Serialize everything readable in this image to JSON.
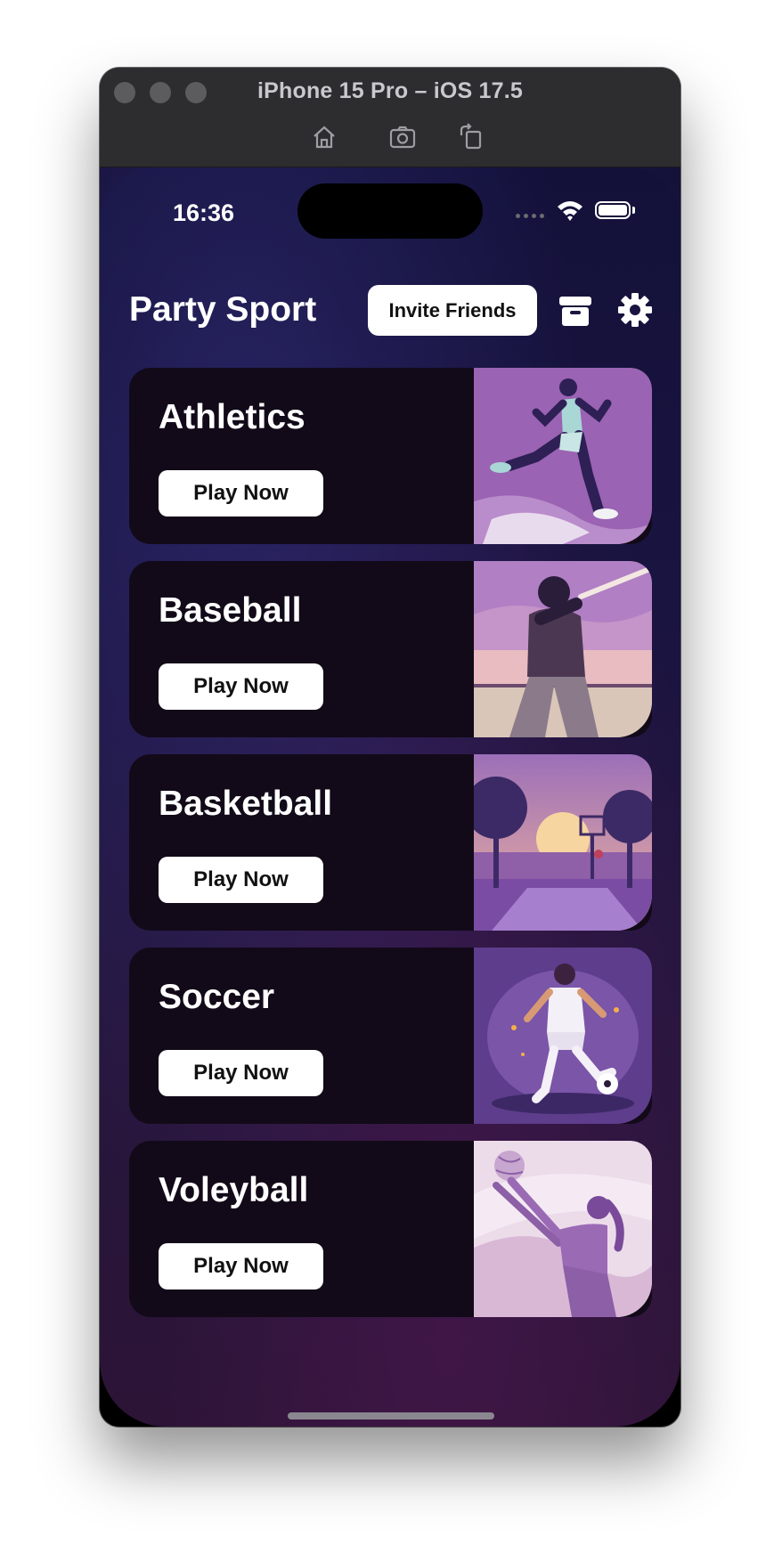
{
  "window": {
    "title": "iPhone 15 Pro – iOS 17.5",
    "toolbar": [
      "home-icon",
      "screenshot-icon",
      "rotate-icon"
    ]
  },
  "status_bar": {
    "time": "16:36"
  },
  "header": {
    "app_title": "Party Sport",
    "invite_label": "Invite Friends"
  },
  "sports": [
    {
      "name": "Athletics",
      "button": "Play Now",
      "image": "runner-illustration"
    },
    {
      "name": "Baseball",
      "button": "Play Now",
      "image": "batter-illustration"
    },
    {
      "name": "Basketball",
      "button": "Play Now",
      "image": "basketball-court-illustration"
    },
    {
      "name": "Soccer",
      "button": "Play Now",
      "image": "soccer-player-illustration"
    },
    {
      "name": "Voleyball",
      "button": "Play Now",
      "image": "volleyball-player-illustration"
    }
  ],
  "colors": {
    "card_bg": "#120a18",
    "accent_purple": "#8c5bb0",
    "button_bg": "#ffffff"
  }
}
